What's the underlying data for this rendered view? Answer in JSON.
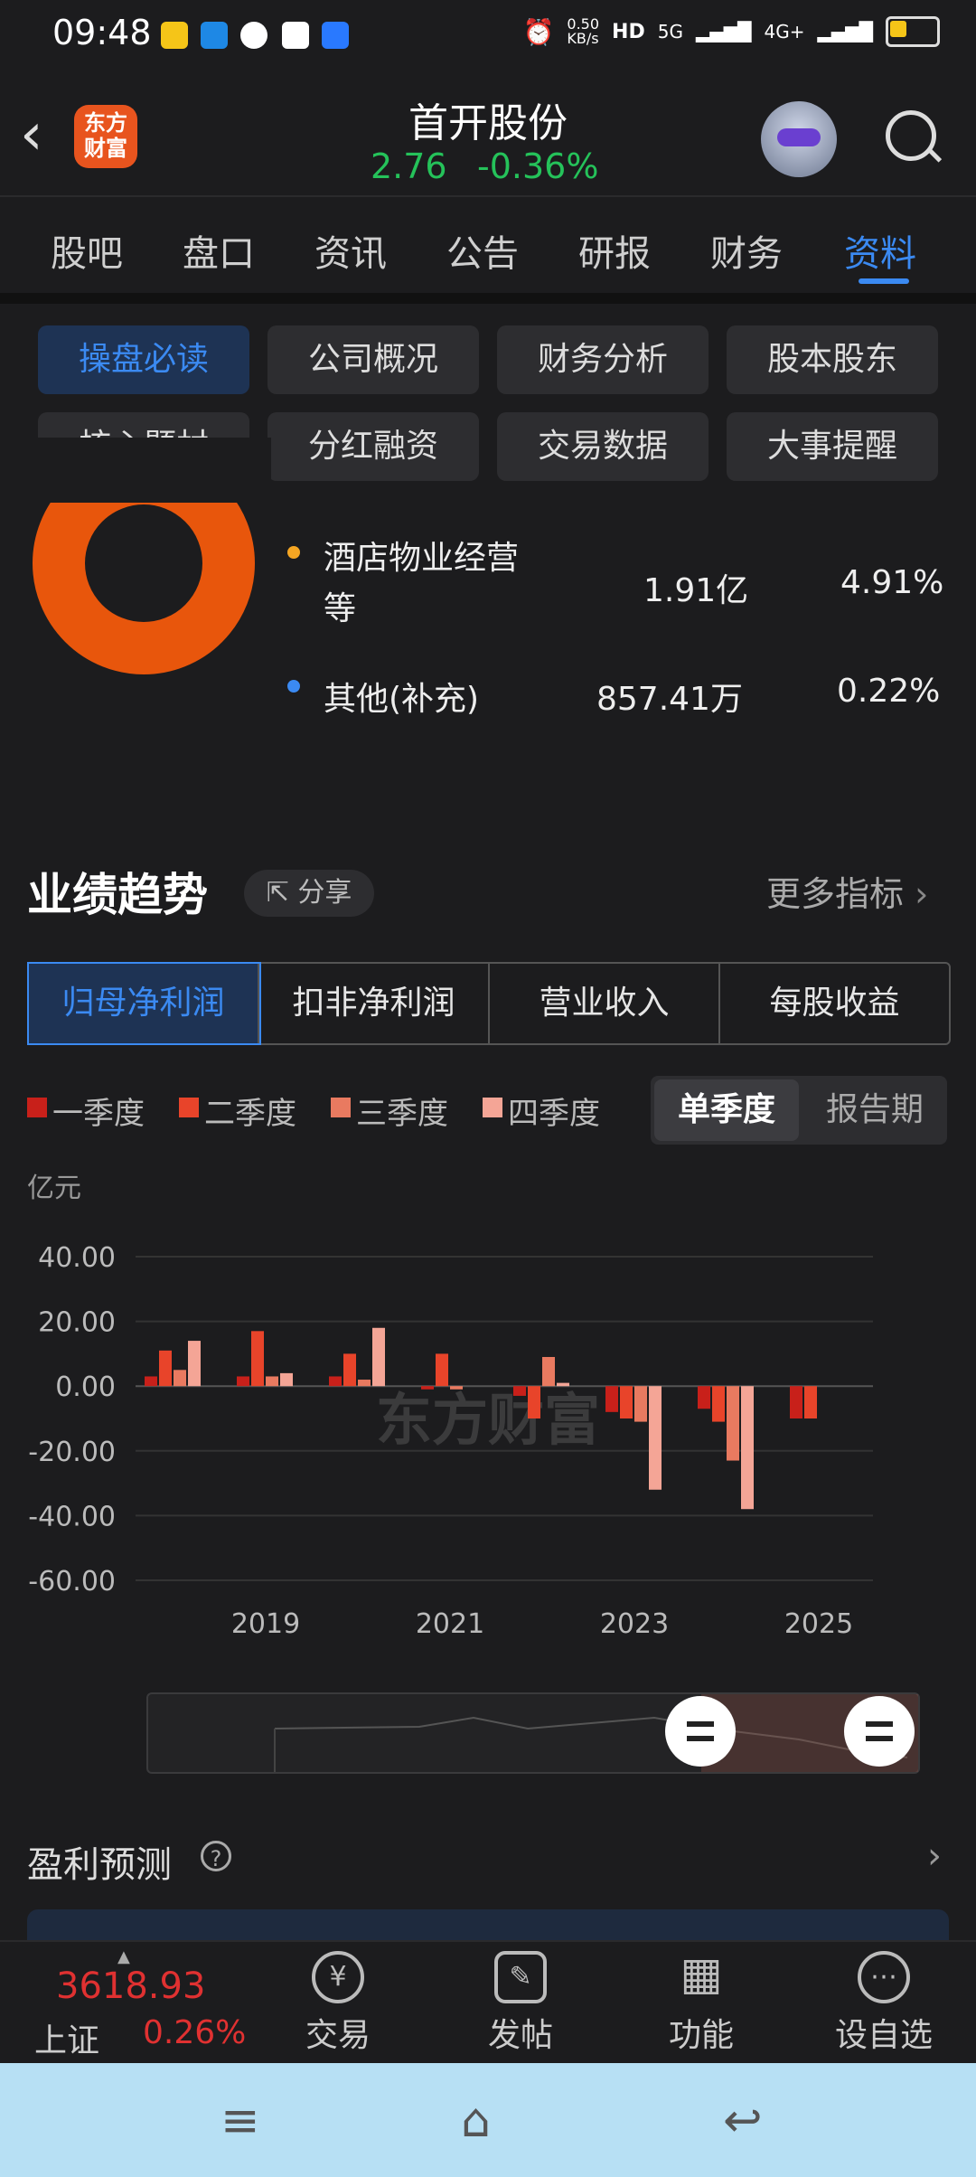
{
  "status_bar": {
    "time": "09:48",
    "net_speed": "0.50\nKB/s",
    "signal_1": "5G",
    "signal_2": "4G+"
  },
  "header": {
    "back_icon": "back-arrow-icon",
    "logo_text": "东方\n财富",
    "stock_name": "首开股份",
    "price": "2.76",
    "change": "-0.36%"
  },
  "tabs": [
    "股吧",
    "盘口",
    "资讯",
    "公告",
    "研报",
    "财务",
    "资料"
  ],
  "active_tab": "资料",
  "sub_tabs": [
    "操盘必读",
    "公司概况",
    "财务分析",
    "股本股东",
    "核心题材",
    "分红融资",
    "交易数据",
    "大事提醒"
  ],
  "active_sub_tab": "操盘必读",
  "composition": [
    {
      "name": "酒店物业经营等",
      "amount": "1.91亿",
      "pct": "4.91%",
      "color": "#f5a623"
    },
    {
      "name": "其他(补充)",
      "amount": "857.41万",
      "pct": "0.22%",
      "color": "#3b8af2"
    }
  ],
  "performance": {
    "title": "业绩趋势",
    "share": "分享",
    "more": "更多指标",
    "metric_tabs": [
      "归母净利润",
      "扣非净利润",
      "营业收入",
      "每股收益"
    ],
    "active_metric": "归母净利润",
    "quarter_legend": [
      "一季度",
      "二季度",
      "三季度",
      "四季度"
    ],
    "quarter_colors": [
      "#c8201a",
      "#e8442a",
      "#e97a60",
      "#f4a596"
    ],
    "period_single": "单季度",
    "period_report": "报告期"
  },
  "chart_data": {
    "type": "bar",
    "unit": "亿元",
    "ylim": [
      -60,
      40
    ],
    "yticks": [
      "40.00",
      "20.00",
      "0.00",
      "-20.00",
      "-40.00",
      "-60.00"
    ],
    "xticks": [
      "2019",
      "2021",
      "2023",
      "2025"
    ],
    "watermark": "东方财富",
    "series": [
      {
        "name": "一季度",
        "values": [
          3,
          3,
          3,
          -1,
          -3,
          -8,
          -7,
          -10
        ]
      },
      {
        "name": "二季度",
        "values": [
          11,
          17,
          10,
          10,
          -10,
          -10,
          -11,
          -10
        ]
      },
      {
        "name": "三季度",
        "values": [
          5,
          3,
          2,
          -1,
          9,
          -11,
          -23,
          null
        ]
      },
      {
        "name": "四季度",
        "values": [
          14,
          4,
          18,
          null,
          1,
          -32,
          -38,
          null
        ]
      }
    ],
    "years": [
      "2018",
      "2019",
      "2020",
      "2021",
      "2022",
      "2023",
      "2024",
      "2025"
    ]
  },
  "forecast": {
    "title": "盈利预测"
  },
  "bottom_bar": {
    "index_value": "3618.93",
    "index_name": "上证",
    "index_pct": "0.26%",
    "buttons": [
      {
        "label": "交易",
        "icon": "trade-icon",
        "glyph": "¥"
      },
      {
        "label": "发帖",
        "icon": "post-icon",
        "glyph": "✎"
      },
      {
        "label": "功能",
        "icon": "grid-icon",
        "glyph": "▦"
      },
      {
        "label": "设自选",
        "icon": "watchlist-icon",
        "glyph": "⋯"
      }
    ]
  }
}
